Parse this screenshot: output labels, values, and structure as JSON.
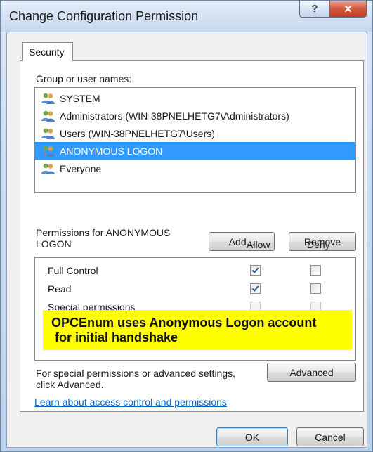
{
  "window": {
    "title": "Change Configuration Permission",
    "help_glyph": "?",
    "close_glyph": "✕"
  },
  "tab": {
    "label": "Security"
  },
  "group_list": {
    "label": "Group or user names:",
    "items": [
      {
        "name": "SYSTEM",
        "selected": false
      },
      {
        "name": "Administrators (WIN-38PNELHETG7\\Administrators)",
        "selected": false
      },
      {
        "name": "Users (WIN-38PNELHETG7\\Users)",
        "selected": false
      },
      {
        "name": "ANONYMOUS LOGON",
        "selected": true
      },
      {
        "name": "Everyone",
        "selected": false
      }
    ]
  },
  "buttons": {
    "add": "Add...",
    "remove": "Remove",
    "advanced": "Advanced",
    "ok": "OK",
    "cancel": "Cancel"
  },
  "permissions": {
    "label_line1": "Permissions for ANONYMOUS",
    "label_line2": "LOGON",
    "allow_header": "Allow",
    "deny_header": "Deny",
    "rows": [
      {
        "name": "Full Control",
        "allow": true,
        "deny": false,
        "disabled": false
      },
      {
        "name": "Read",
        "allow": true,
        "deny": false,
        "disabled": false
      },
      {
        "name": "Special permissions",
        "allow": false,
        "deny": false,
        "disabled": true
      }
    ]
  },
  "annotation": {
    "line1": "OPCEnum uses Anonymous Logon account",
    "line2": " for initial handshake",
    "color": "#ffff00"
  },
  "advanced_section": {
    "line1": "For special permissions or advanced settings,",
    "line2": "click Advanced."
  },
  "link": {
    "text": "Learn about access control and permissions"
  },
  "colors": {
    "selection": "#3399ff",
    "link": "#0066cc",
    "check": "#2d5a9e"
  },
  "icons": {
    "user_group": "users-group-icon",
    "checkmark": "checkmark-icon",
    "help": "help-icon",
    "close": "close-icon"
  }
}
